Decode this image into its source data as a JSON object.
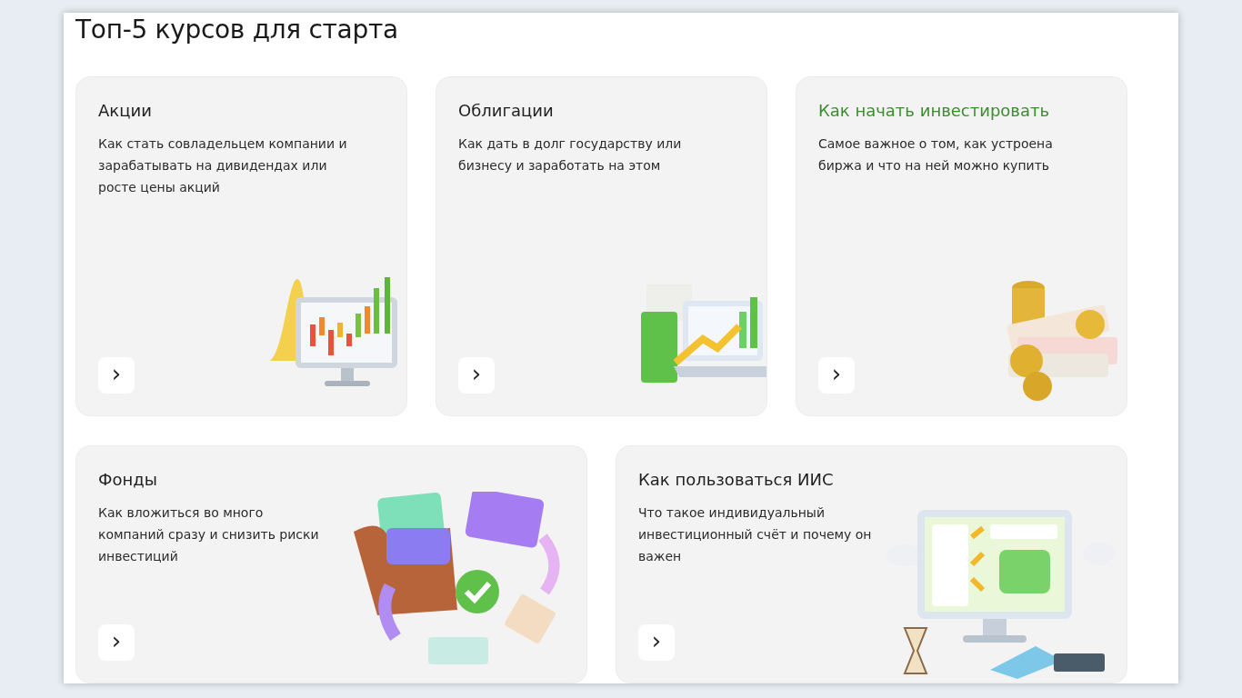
{
  "title": "Топ-5 курсов для старта",
  "courses": [
    {
      "title": "Акции",
      "description": "Как стать совладельцем компании и зарабатывать на дивидендах или росте цены акций",
      "highlighted": false,
      "kind": "chart",
      "wide": false,
      "button": "›"
    },
    {
      "title": "Облигации",
      "description": "Как дать в долг государству или бизнесу и заработать на этом",
      "highlighted": false,
      "kind": "folder",
      "wide": false,
      "button": "›"
    },
    {
      "title": "Как начать инвестировать",
      "description": "Самое важное о том, как устроена биржа и что на ней можно купить",
      "highlighted": true,
      "kind": "coins",
      "wide": false,
      "button": "›"
    },
    {
      "title": "Фонды",
      "description": "Как вложиться во много компаний сразу и снизить риски инвестиций",
      "highlighted": false,
      "kind": "wallet",
      "wide": true,
      "button": "›"
    },
    {
      "title": "Как пользоваться ИИС",
      "description": "Что такое индивидуальный инвестиционный счёт и почему он важен",
      "highlighted": false,
      "kind": "monitor",
      "wide": true,
      "button": "›"
    }
  ]
}
